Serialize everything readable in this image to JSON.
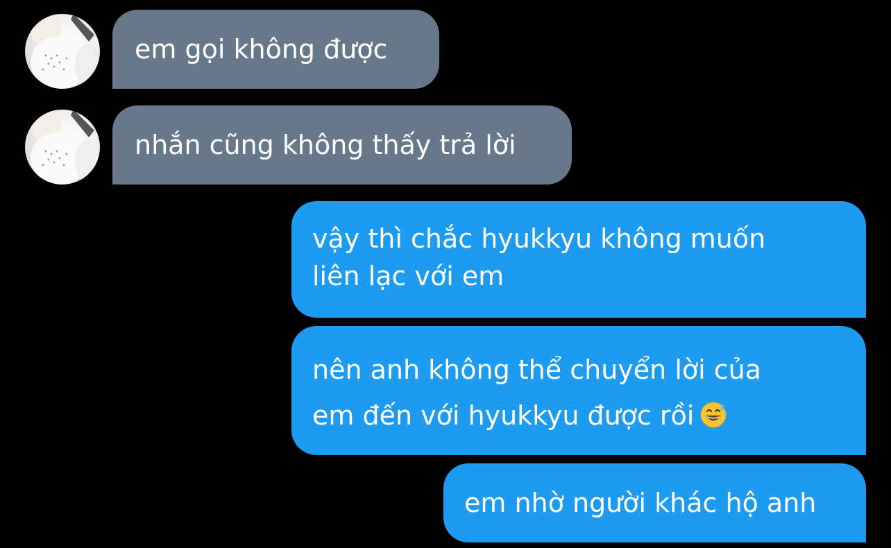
{
  "conversation": {
    "messages": [
      {
        "direction": "incoming",
        "lines": [
          "em gọi không được"
        ]
      },
      {
        "direction": "incoming",
        "lines": [
          "nhắn cũng không thấy trả lời"
        ]
      },
      {
        "direction": "outgoing",
        "lines": [
          "vậy thì chắc hyukkyu không muốn",
          "liên lạc với em"
        ]
      },
      {
        "direction": "outgoing",
        "lines": [
          "nên anh không thể chuyển lời của",
          "em đến với hyukkyu được rồi"
        ],
        "emoji": "grinning-sweat-emoji"
      },
      {
        "direction": "outgoing",
        "lines": [
          "em nhờ người khác hộ anh"
        ]
      }
    ]
  },
  "colors": {
    "background": "#000000",
    "incoming_bubble": "#66788a",
    "outgoing_bubble": "#1d9bf0",
    "text": "#ffffff"
  },
  "icons": {
    "avatar": "contact-avatar-photo",
    "emoji": "grinning-face-with-sweat"
  }
}
